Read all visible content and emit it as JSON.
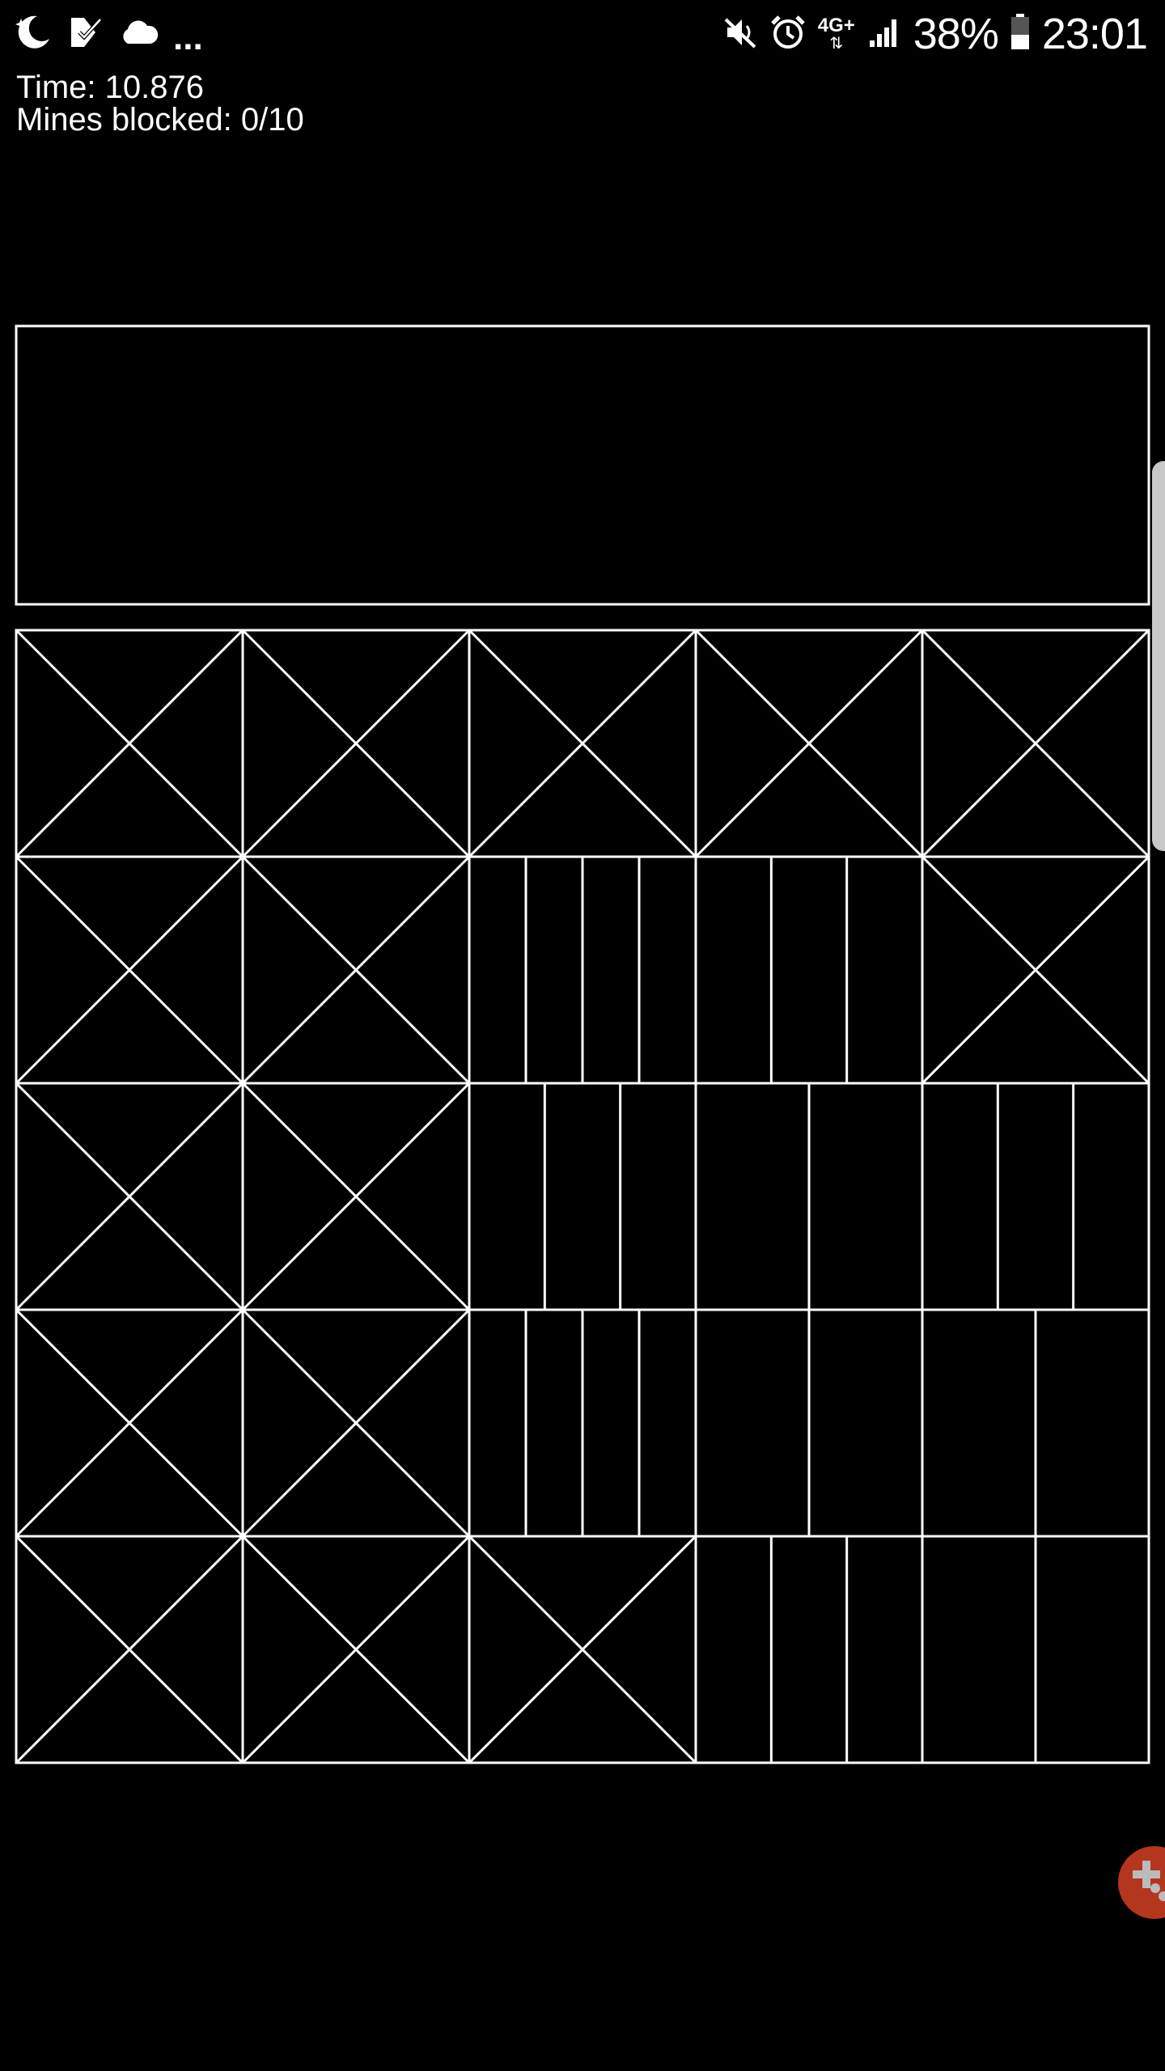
{
  "status_bar": {
    "icons_left": [
      "moon-icon",
      "task-check-icon",
      "cloud-icon"
    ],
    "overflow": "...",
    "icons_right": [
      "mute-icon",
      "alarm-icon",
      "network-4g-icon",
      "signal-icon",
      "battery-icon"
    ],
    "network_label": "4G+",
    "battery": "38%",
    "time": "23:01"
  },
  "hud": {
    "time_label": "Time: 10.876",
    "mines_label": "Mines blocked: 0/10"
  },
  "board": {
    "rows": 5,
    "cols": 5,
    "cells": [
      [
        "x",
        "x",
        "x",
        "x",
        "x"
      ],
      [
        "x",
        "x",
        "v3",
        "v2",
        "x"
      ],
      [
        "x",
        "x",
        "v2",
        "v1",
        "v2"
      ],
      [
        "x",
        "x",
        "v3",
        "v1",
        "v1"
      ],
      [
        "x",
        "x",
        "x",
        "v2",
        "v1"
      ]
    ]
  },
  "fab": {
    "icon": "gamepad-icon"
  },
  "colors": {
    "background": "#000000",
    "line": "#ffffff",
    "fab": "#b5361f"
  }
}
